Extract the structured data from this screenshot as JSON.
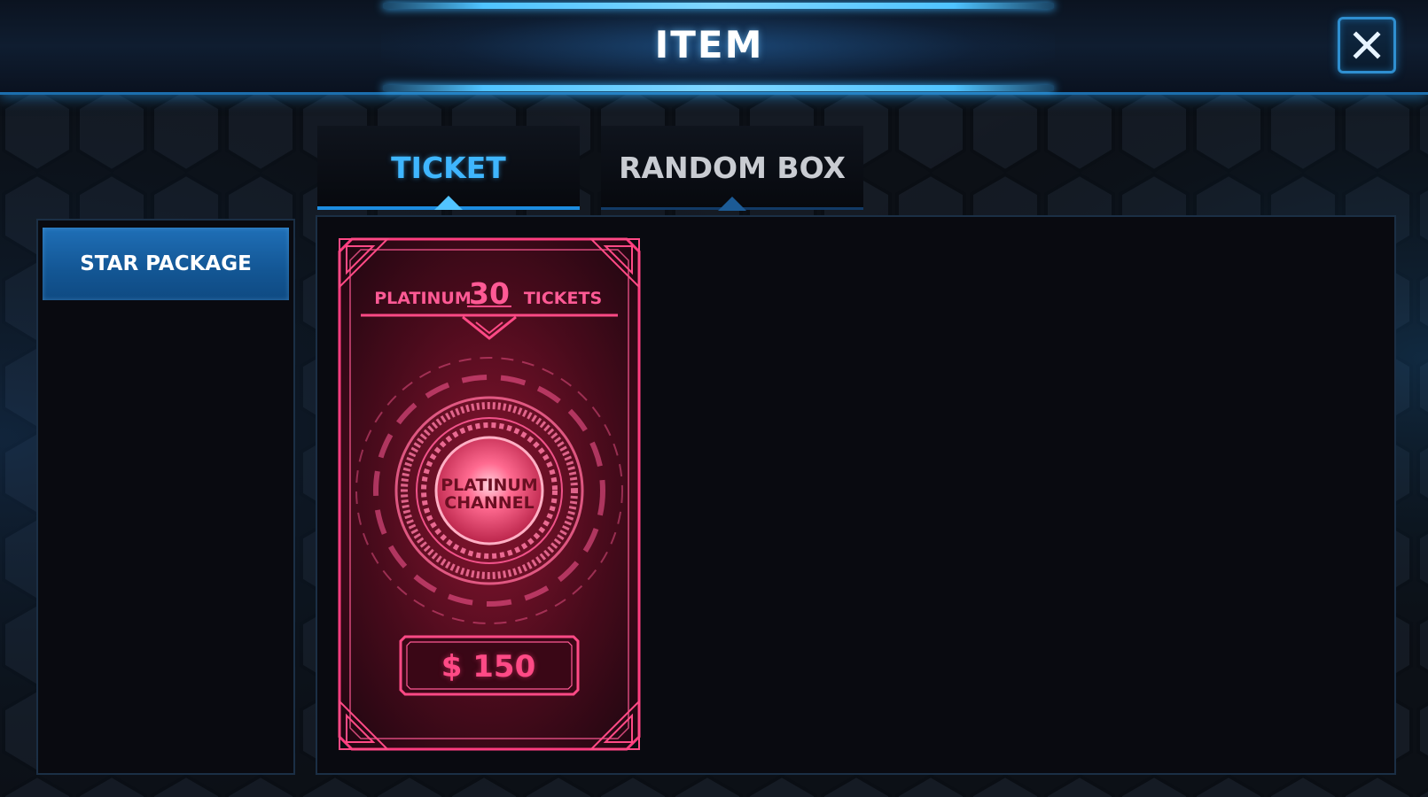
{
  "header": {
    "title": "ITEM"
  },
  "tabs": [
    {
      "label": "TICKET",
      "active": true
    },
    {
      "label": "RANDOM BOX",
      "active": false
    }
  ],
  "sidebar": {
    "items": [
      {
        "label": "STAR PACKAGE",
        "selected": true
      }
    ]
  },
  "products": [
    {
      "left_text": "PLATINUM",
      "quantity": "30",
      "right_text": "TICKETS",
      "emblem_text": [
        "PLATINUM",
        "CHANNEL"
      ],
      "price": "$ 150"
    }
  ],
  "colors": {
    "accent_blue": "#3fb6ff",
    "ticket_pink": "#ff3d7f",
    "background": "#0c1016"
  },
  "icons": {
    "close": "close-x-icon"
  }
}
